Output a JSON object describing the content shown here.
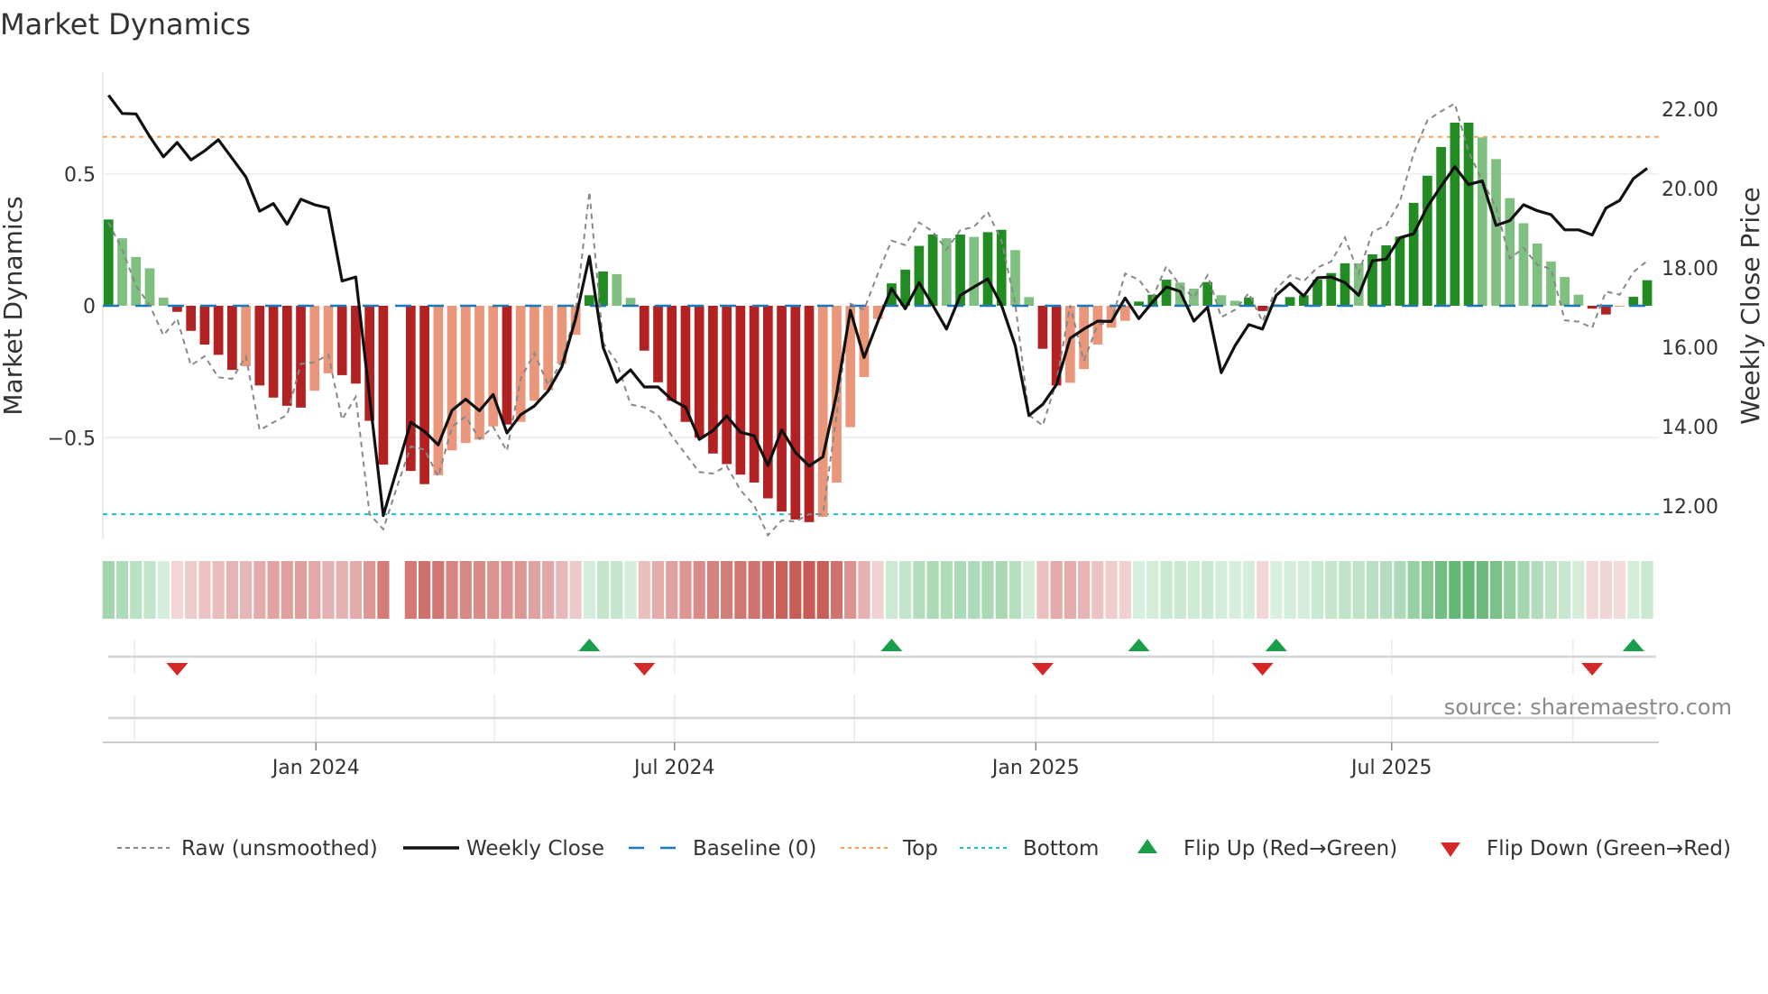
{
  "title": "Market Dynamics",
  "source": "source: sharemaestro.com",
  "colors": {
    "rising_green": "#228b22",
    "falling_green": "#7fbf7f",
    "falling_red": "#b22222",
    "rising_red": "#e9967a",
    "close": "#111111",
    "raw": "#888888",
    "baseline": "#1f77b4",
    "top": "#f4a460",
    "bottom": "#17becf",
    "flip_up": "#1a9e4a",
    "flip_down": "#d62728"
  },
  "legend": [
    {
      "key": "raw",
      "label": "Raw (unsmoothed)"
    },
    {
      "key": "close",
      "label": "Weekly Close"
    },
    {
      "key": "baseline",
      "label": "Baseline (0)"
    },
    {
      "key": "top",
      "label": "Top"
    },
    {
      "key": "bottom",
      "label": "Bottom"
    },
    {
      "key": "flip_up",
      "label": "Flip Up (Red→Green)"
    },
    {
      "key": "flip_down",
      "label": "Flip Down (Green→Red)"
    }
  ],
  "chart_data": {
    "type": "bar",
    "title": "Market Dynamics",
    "ylabel": "Market Dynamics",
    "y2label": "Weekly Close Price",
    "ylim": [
      -0.89,
      0.89
    ],
    "y2lim": [
      11.2,
      23.0
    ],
    "yticks": [
      {
        "v": 0.5,
        "label": "0.5"
      },
      {
        "v": 0,
        "label": "0"
      },
      {
        "v": -0.5,
        "label": "−0.5"
      }
    ],
    "y2ticks": [
      {
        "v": 22,
        "label": "22.00"
      },
      {
        "v": 20,
        "label": "20.00"
      },
      {
        "v": 18,
        "label": "18.00"
      },
      {
        "v": 16,
        "label": "16.00"
      },
      {
        "v": 14,
        "label": "14.00"
      },
      {
        "v": 12,
        "label": "12.00"
      }
    ],
    "xticks": [
      {
        "week": 15.1,
        "label": "Jan 2024"
      },
      {
        "week": 41.2,
        "label": "Jul 2024"
      },
      {
        "week": 67.5,
        "label": "Jan 2025"
      },
      {
        "week": 93.4,
        "label": "Jul 2025"
      }
    ],
    "quarter_grid_weeks": [
      1.9,
      15.1,
      28.1,
      41.2,
      54.3,
      67.5,
      80.4,
      93.4,
      106.6
    ],
    "top_level": 0.64,
    "bottom_level": -0.79,
    "momentum": [
      0.327,
      0.256,
      0.185,
      0.142,
      0.031,
      -0.023,
      -0.095,
      -0.147,
      -0.186,
      -0.243,
      -0.229,
      -0.302,
      -0.348,
      -0.379,
      -0.386,
      -0.322,
      -0.256,
      -0.263,
      -0.295,
      -0.436,
      -0.602,
      null,
      -0.626,
      -0.676,
      -0.642,
      -0.548,
      -0.52,
      -0.507,
      -0.457,
      -0.45,
      -0.44,
      -0.36,
      -0.32,
      -0.22,
      -0.11,
      0.04,
      0.13,
      0.12,
      0.03,
      -0.17,
      -0.29,
      -0.36,
      -0.44,
      -0.5,
      -0.56,
      -0.6,
      -0.64,
      -0.67,
      -0.73,
      -0.78,
      -0.81,
      -0.82,
      -0.8,
      -0.67,
      -0.46,
      -0.27,
      -0.05,
      0.085,
      0.137,
      0.227,
      0.27,
      0.256,
      0.27,
      0.261,
      0.279,
      0.288,
      0.211,
      0.033,
      -0.163,
      -0.302,
      -0.292,
      -0.24,
      -0.147,
      -0.083,
      -0.057,
      0.016,
      0.042,
      0.099,
      0.088,
      0.065,
      0.09,
      0.04,
      0.019,
      0.031,
      -0.02,
      0.005,
      0.033,
      0.04,
      0.099,
      0.124,
      0.161,
      0.161,
      0.195,
      0.229,
      0.262,
      0.39,
      0.493,
      0.602,
      0.694,
      0.694,
      0.638,
      0.556,
      0.408,
      0.313,
      0.236,
      0.168,
      0.109,
      0.042,
      -0.011,
      -0.033,
      -0.003,
      0.034,
      0.097
    ],
    "state": [
      "G",
      "g",
      "g",
      "g",
      "g",
      "R",
      "R",
      "R",
      "R",
      "R",
      "r",
      "R",
      "R",
      "R",
      "R",
      "r",
      "r",
      "R",
      "R",
      "R",
      "R",
      null,
      "R",
      "R",
      "r",
      "r",
      "r",
      "r",
      "r",
      "R",
      "r",
      "r",
      "r",
      "r",
      "r",
      "G",
      "G",
      "g",
      "g",
      "R",
      "R",
      "R",
      "R",
      "R",
      "R",
      "R",
      "R",
      "R",
      "R",
      "R",
      "R",
      "R",
      "r",
      "r",
      "r",
      "r",
      "r",
      "G",
      "G",
      "G",
      "G",
      "g",
      "G",
      "g",
      "G",
      "G",
      "g",
      "g",
      "R",
      "R",
      "r",
      "r",
      "r",
      "r",
      "r",
      "G",
      "G",
      "G",
      "g",
      "g",
      "G",
      "g",
      "g",
      "G",
      "R",
      "G",
      "G",
      "G",
      "G",
      "G",
      "G",
      "g",
      "G",
      "G",
      "G",
      "G",
      "G",
      "G",
      "G",
      "G",
      "g",
      "g",
      "g",
      "g",
      "g",
      "g",
      "g",
      "g",
      "R",
      "R",
      "r",
      "G",
      "G"
    ],
    "weekly_close": [
      22.35,
      21.89,
      21.88,
      21.31,
      20.8,
      21.16,
      20.72,
      20.95,
      21.23,
      20.76,
      20.29,
      19.43,
      19.62,
      19.1,
      19.73,
      19.59,
      19.51,
      17.67,
      17.77,
      14.75,
      11.76,
      12.93,
      14.11,
      13.88,
      13.54,
      14.41,
      14.69,
      14.4,
      14.81,
      13.84,
      14.3,
      14.52,
      14.9,
      15.51,
      16.72,
      18.29,
      16.0,
      15.12,
      15.43,
      15.0,
      15.0,
      14.68,
      14.49,
      13.68,
      13.9,
      14.27,
      13.86,
      13.77,
      13.02,
      13.92,
      13.35,
      13.01,
      13.24,
      14.83,
      16.93,
      15.74,
      16.65,
      17.48,
      16.97,
      17.63,
      17.06,
      16.46,
      17.31,
      17.52,
      17.72,
      17.06,
      16.04,
      14.28,
      14.56,
      15.06,
      16.23,
      16.46,
      16.66,
      16.65,
      17.24,
      16.72,
      17.14,
      17.52,
      17.41,
      16.66,
      17.01,
      15.36,
      16.04,
      16.57,
      16.46,
      17.31,
      17.61,
      17.29,
      17.75,
      17.77,
      17.63,
      17.31,
      18.18,
      18.22,
      18.76,
      18.86,
      19.54,
      20.06,
      20.55,
      20.1,
      20.19,
      19.07,
      19.19,
      19.59,
      19.44,
      19.34,
      18.96,
      18.96,
      18.83,
      19.51,
      19.7,
      20.25,
      20.51
    ],
    "raw": [
      0.316,
      0.213,
      0.076,
      0.002,
      -0.112,
      -0.049,
      -0.226,
      -0.191,
      -0.271,
      -0.277,
      -0.191,
      -0.471,
      -0.442,
      -0.414,
      -0.22,
      -0.214,
      -0.186,
      -0.431,
      -0.345,
      -0.79,
      -0.847,
      -0.687,
      -0.533,
      -0.545,
      -0.647,
      -0.459,
      -0.419,
      -0.505,
      -0.459,
      -0.55,
      -0.277,
      -0.18,
      -0.3,
      -0.209,
      -0.026,
      0.432,
      -0.14,
      -0.214,
      -0.374,
      -0.385,
      -0.414,
      -0.493,
      -0.562,
      -0.63,
      -0.636,
      -0.607,
      -0.699,
      -0.756,
      -0.87,
      -0.813,
      -0.818,
      -0.79,
      -0.79,
      -0.414,
      0.008,
      -0.015,
      0.122,
      0.247,
      0.23,
      0.316,
      0.281,
      0.213,
      0.287,
      0.299,
      0.356,
      0.247,
      0.008,
      -0.414,
      -0.454,
      -0.288,
      0.002,
      -0.209,
      -0.072,
      -0.06,
      0.122,
      0.099,
      0.031,
      0.15,
      0.076,
      0.031,
      0.116,
      -0.043,
      -0.015,
      0.048,
      -0.06,
      0.065,
      0.116,
      0.093,
      0.145,
      0.168,
      0.259,
      0.122,
      0.281,
      0.304,
      0.395,
      0.578,
      0.703,
      0.737,
      0.766,
      0.583,
      0.475,
      0.373,
      0.179,
      0.219,
      0.156,
      0.139,
      -0.055,
      -0.06,
      -0.083,
      0.054,
      0.042,
      0.128,
      0.17
    ],
    "flip_up_weeks": [
      35,
      57,
      75,
      85,
      111
    ],
    "flip_down_weeks": [
      5,
      39,
      68,
      84,
      108
    ]
  }
}
